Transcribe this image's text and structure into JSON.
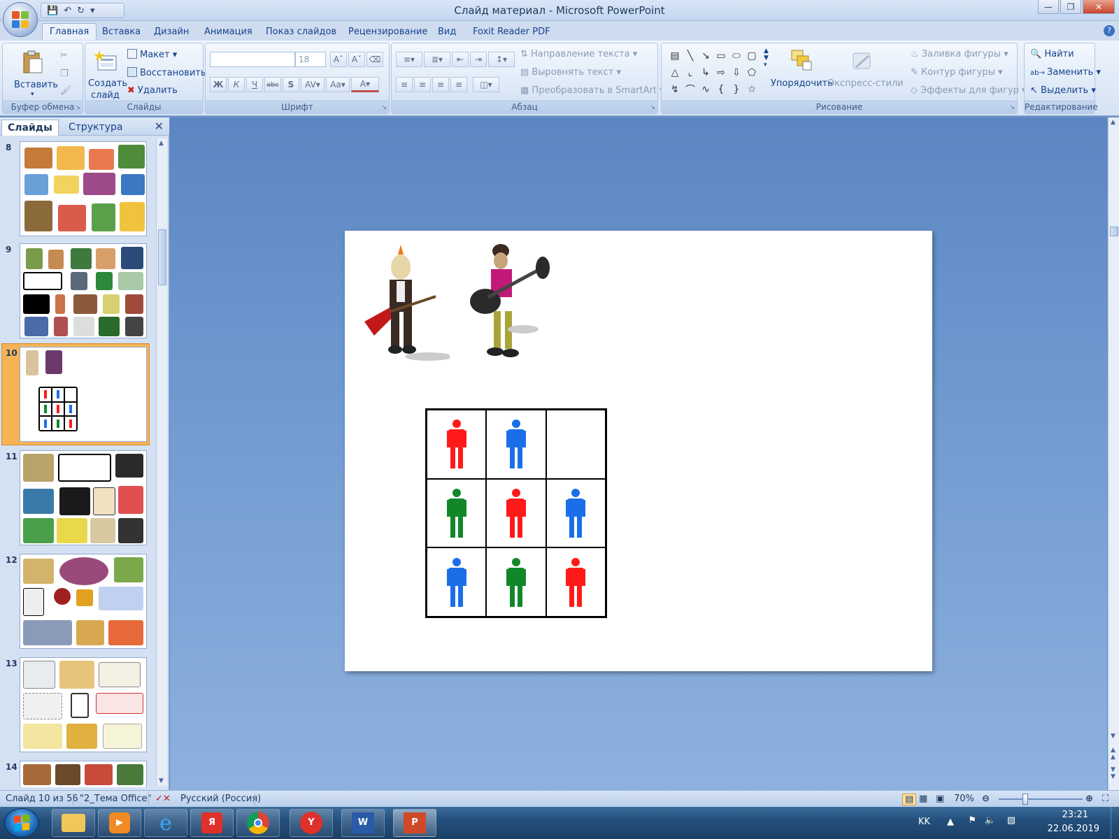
{
  "window": {
    "title": "Слайд материал - Microsoft PowerPoint"
  },
  "ribbon": {
    "tabs": [
      "Главная",
      "Вставка",
      "Дизайн",
      "Анимация",
      "Показ слайдов",
      "Рецензирование",
      "Вид",
      "Foxit Reader PDF"
    ],
    "active_tab": "Главная",
    "clipboard": {
      "label": "Буфер обмена",
      "paste": "Вставить"
    },
    "slides": {
      "label": "Слайды",
      "new_slide_1": "Создать",
      "new_slide_2": "слайд",
      "layout": "Макет",
      "reset": "Восстановить",
      "delete": "Удалить"
    },
    "font": {
      "label": "Шрифт",
      "size": "18",
      "bold": "Ж",
      "italic": "К",
      "underline": "Ч",
      "strike": "abc",
      "shadow": "S"
    },
    "paragraph": {
      "label": "Абзац",
      "text_direction": "Направление текста",
      "align_text": "Выровнять текст",
      "smartart": "Преобразовать в SmartArt"
    },
    "drawing": {
      "label": "Рисование",
      "arrange": "Упорядочить",
      "quick_styles": "Экспресс-стили",
      "fill": "Заливка фигуры",
      "outline": "Контур фигуры",
      "effects": "Эффекты для фигур"
    },
    "editing": {
      "label": "Редактирование",
      "find": "Найти",
      "replace": "Заменить",
      "select": "Выделить"
    }
  },
  "pane": {
    "tabs": [
      "Слайды",
      "Структура"
    ],
    "slide_numbers": [
      "8",
      "9",
      "10",
      "11",
      "12",
      "13",
      "14"
    ],
    "selected": "10"
  },
  "slide_grid": {
    "cells": [
      "red",
      "blue",
      "",
      "green",
      "red",
      "blue",
      "blue",
      "green",
      "red"
    ]
  },
  "colors": {
    "red": "#ff1a1a",
    "blue": "#1a6fe8",
    "green": "#12872a"
  },
  "status": {
    "slide_info": "Слайд 10 из 56",
    "theme": "\"2_Тема Office\"",
    "language": "Русский (Россия)",
    "zoom": "70%"
  },
  "taskbar": {
    "lang": "KK",
    "time": "23:21",
    "date": "22.06.2019"
  }
}
